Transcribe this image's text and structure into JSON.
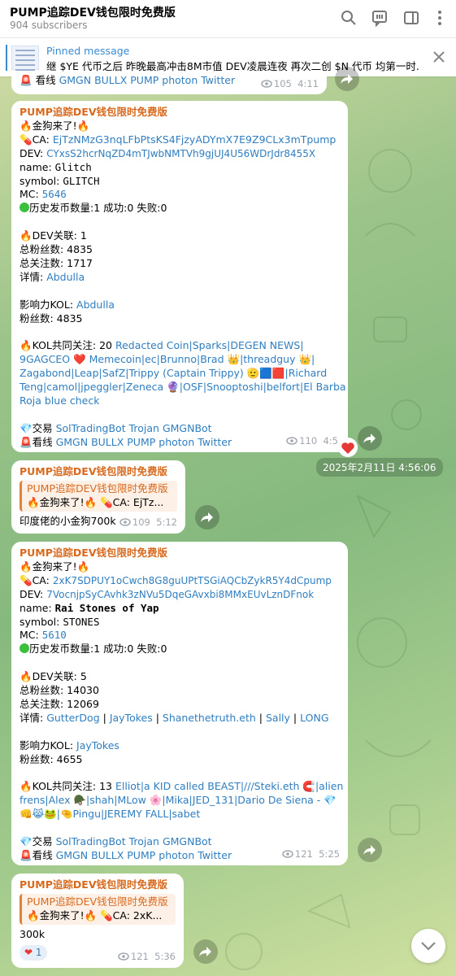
{
  "header": {
    "title": "PUMP追踪DEV钱包限时免费版",
    "subscribers": "904 subscribers"
  },
  "pinned": {
    "label": "Pinned message",
    "text": "继 $YE 代币之后 昨晚最高冲击8M市值 DEV凌晨连夜 再次二创 $N 代币 均第一时..."
  },
  "top_partial": {
    "watch": "看线",
    "links": [
      "GMGN",
      "BULLX",
      "PUMP",
      "photon",
      "Twitter"
    ],
    "views": "105",
    "time": "4:11"
  },
  "msg1": {
    "channel": "PUMP追踪DEV钱包限时免费版",
    "headline": "金狗来了!",
    "ca_label": "CA: ",
    "ca": "EjTzNMzG3nqLFbPtsKS4FjzyADYmX7E9Z9CLx3mTpump",
    "dev_label": "DEV: ",
    "dev": "CYxsS2hcrNqZD4mTJwbNMTVh9gjUJ4U56WDrJdr8455X",
    "name_label": "name: ",
    "name": "Glitch",
    "symbol_label": "symbol: ",
    "symbol": "GLITCH",
    "mc_label": "MC: ",
    "mc": "5646",
    "history": "历史发币数量:1 成功:0 失败:0",
    "dev_rel": "DEV关联: 1",
    "followers_total": "总粉丝数: 4835",
    "following_total": "总关注数: 1717",
    "detail_label": "详情: ",
    "detail": "Abdulla",
    "kol_label": "影响力KOL: ",
    "kol": "Abdulla",
    "kol_fans": "粉丝数: 4835",
    "common_label": "KOL共同关注: 20 ",
    "common": [
      "Redacted Coin|Sparks|DEGEN NEWS|",
      "9GAGCEO ❤️ Memecoin|ec|Brunno|Brad 👑|threadguy 👑|",
      "Zagabond|Leap|SafZ|Trippy (Captain Trippy) 🫡🟦🟥|Richard",
      "Teng|camol|jpeggler|Zeneca 🔮|OSF|Snooptoshi|belfort|El Barba",
      "Roja blue check"
    ],
    "trade_label": "交易 ",
    "trade_links": [
      "SolTradingBot",
      "Trojan",
      "GMGNBot"
    ],
    "watch_label": "看线 ",
    "watch_links": [
      "GMGN",
      "BULLX",
      "PUMP",
      "photon",
      "Twitter"
    ],
    "views": "110",
    "time": "4:5"
  },
  "date_pill": "2025年2月11日 4:56:06",
  "reply1": {
    "channel": "PUMP追踪DEV钱包限时免费版",
    "quote_title": "PUMP追踪DEV钱包限时免费版",
    "quote_text": "🔥金狗来了!🔥 💊CA: EjTz...",
    "text": "印度佬的小金狗700k",
    "views": "109",
    "time": "5:12"
  },
  "msg2": {
    "channel": "PUMP追踪DEV钱包限时免费版",
    "headline": "金狗来了!",
    "ca_label": "CA: ",
    "ca": "2xK7SDPUY1oCwch8G8guUPtTSGiAQCbZykR5Y4dCpump",
    "dev_label": "DEV: ",
    "dev": "7VocnjpSyCAvhk3zNVu5DqeGAvxbi8MMxEUvLznDFnok",
    "name_label": "name: ",
    "name": "Rai Stones of Yap",
    "symbol_label": "symbol: ",
    "symbol": "STONES",
    "mc_label": "MC: ",
    "mc": "5610",
    "history": "历史发币数量:1 成功:0 失败:0",
    "dev_rel": "DEV关联: 5",
    "followers_total": "总粉丝数: 14030",
    "following_total": "总关注数: 12069",
    "detail_label": "详情: ",
    "detail_links": [
      "GutterDog",
      "JayTokes",
      "Shanethetruth.eth",
      "Sally",
      "LONG"
    ],
    "kol_label": "影响力KOL: ",
    "kol": "JayTokes",
    "kol_fans": "粉丝数: 4655",
    "common_label": "KOL共同关注: 13 ",
    "common": [
      "Elliot|a KID called BEAST|///Steki.eth 🧲|alien",
      "frens|Alex 🪖|shah|MLow 🌸|Mika|JED_131|Dario De Siena - 💎",
      "👊😹🐸|🤏Pingu|JEREMY FALL|sabet"
    ],
    "trade_label": "交易 ",
    "trade_links": [
      "SolTradingBot",
      "Trojan",
      "GMGNBot"
    ],
    "watch_label": "看线 ",
    "watch_links": [
      "GMGN",
      "BULLX",
      "PUMP",
      "photon",
      "Twitter"
    ],
    "views": "121",
    "time": "5:25"
  },
  "reply2": {
    "channel": "PUMP追踪DEV钱包限时免费版",
    "quote_title": "PUMP追踪DEV钱包限时免费版",
    "quote_text": "🔥金狗来了!🔥 💊CA: 2xK...",
    "text": "300k",
    "reaction_count": "1",
    "views": "121",
    "time": "5:36"
  }
}
